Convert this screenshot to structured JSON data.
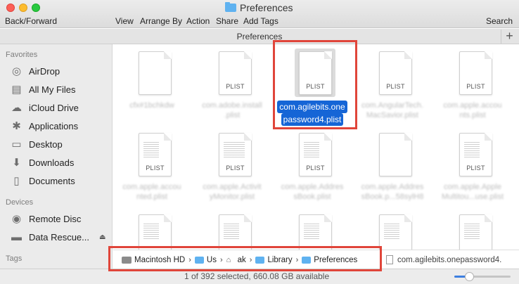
{
  "window": {
    "title": "Preferences"
  },
  "toolbar": {
    "back_forward": "Back/Forward",
    "view": "View",
    "arrange_by": "Arrange By",
    "action": "Action",
    "share": "Share",
    "add_tags": "Add Tags",
    "search": "Search"
  },
  "path_header": {
    "title": "Preferences",
    "add_label": "+"
  },
  "sidebar": {
    "favorites_title": "Favorites",
    "favorites": [
      {
        "label": "AirDrop",
        "icon": "airdrop-icon"
      },
      {
        "label": "All My Files",
        "icon": "all-files-icon"
      },
      {
        "label": "iCloud Drive",
        "icon": "cloud-icon"
      },
      {
        "label": "Applications",
        "icon": "applications-icon"
      },
      {
        "label": "Desktop",
        "icon": "desktop-icon"
      },
      {
        "label": "Downloads",
        "icon": "downloads-icon"
      },
      {
        "label": "Documents",
        "icon": "documents-icon"
      }
    ],
    "devices_title": "Devices",
    "devices": [
      {
        "label": "Remote Disc",
        "icon": "disc-icon"
      },
      {
        "label": "Data Rescue...",
        "icon": "drive-icon"
      }
    ],
    "tags_title": "Tags"
  },
  "files": [
    {
      "label": "",
      "name": "cfx#1bchkdw"
    },
    {
      "label": "PLIST",
      "name": "com.adobe.install .plist"
    },
    {
      "label": "PLIST",
      "name": "com.agilebits.one password4.plist",
      "selected": true,
      "name_line1": "com.agilebits.one",
      "name_line2": "password4.plist"
    },
    {
      "label": "PLIST",
      "name": "com.AngularTech. MacSavior.plist"
    },
    {
      "label": "PLIST",
      "name": "com.apple.accou nts.plist"
    },
    {
      "label": "PLIST",
      "name": "com.apple.accou nted.plist"
    },
    {
      "label": "PLIST",
      "name": "com.apple.Activit yMonitor.plist"
    },
    {
      "label": "PLIST",
      "name": "com.apple.Addres sBook.plist"
    },
    {
      "label": "",
      "name": "com.apple.Addres sBook.p...58sylH8"
    },
    {
      "label": "PLIST",
      "name": "com.apple.Apple Multitou...use.plist"
    },
    {
      "label": "",
      "name": ""
    },
    {
      "label": "",
      "name": ""
    },
    {
      "label": "",
      "name": ""
    },
    {
      "label": "",
      "name": ""
    },
    {
      "label": "",
      "name": ""
    }
  ],
  "pathbar": {
    "crumbs": [
      "Macintosh HD",
      "Us",
      "ak",
      "Library",
      "Preferences"
    ],
    "file": "com.agilebits.onepassword4."
  },
  "status": {
    "text": "1 of 392 selected, 660.08 GB available",
    "zoom_fraction": 0.26
  }
}
